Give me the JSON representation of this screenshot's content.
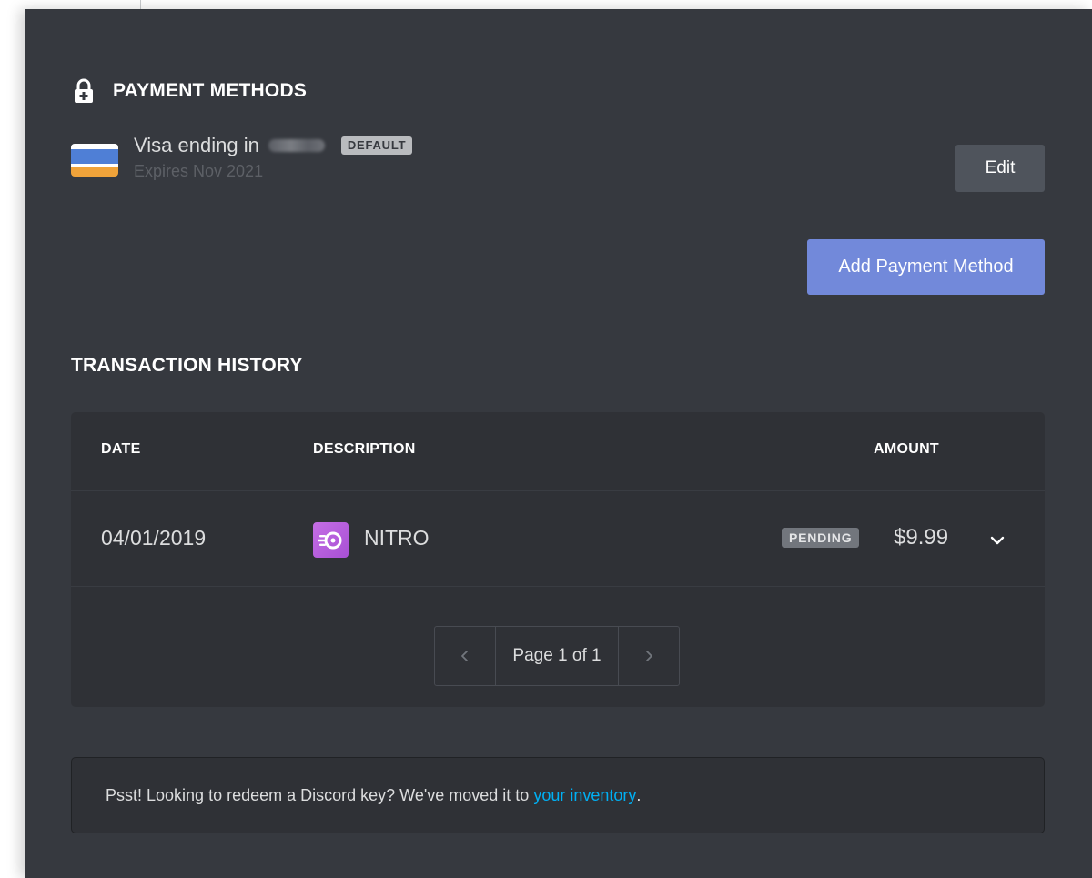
{
  "payment_methods": {
    "title": "PAYMENT METHODS",
    "card": {
      "label": "Visa ending in",
      "badge": "DEFAULT",
      "expiry": "Expires Nov 2021"
    },
    "edit_label": "Edit",
    "add_label": "Add Payment Method"
  },
  "transaction_history": {
    "title": "TRANSACTION HISTORY",
    "columns": [
      "DATE",
      "DESCRIPTION",
      "AMOUNT"
    ],
    "rows": [
      {
        "date": "04/01/2019",
        "description": "NITRO",
        "status": "PENDING",
        "amount": "$9.99"
      }
    ],
    "pagination": {
      "label": "Page 1 of 1"
    }
  },
  "notice": {
    "text": "Psst! Looking to redeem a Discord key? We've moved it to",
    "link": "your inventory",
    "suffix": "."
  },
  "icons": {
    "lock": "lock-icon",
    "card": "credit-card-icon",
    "nitro": "nitro-icon",
    "expand": "chevron-down-icon",
    "prev": "chevron-left-icon",
    "next": "chevron-right-icon"
  },
  "colors": {
    "panel_bg": "#36393f",
    "table_bg": "#2f3136",
    "accent": "#7289da",
    "link": "#00b0f4",
    "nitro": "#b65fdd"
  }
}
